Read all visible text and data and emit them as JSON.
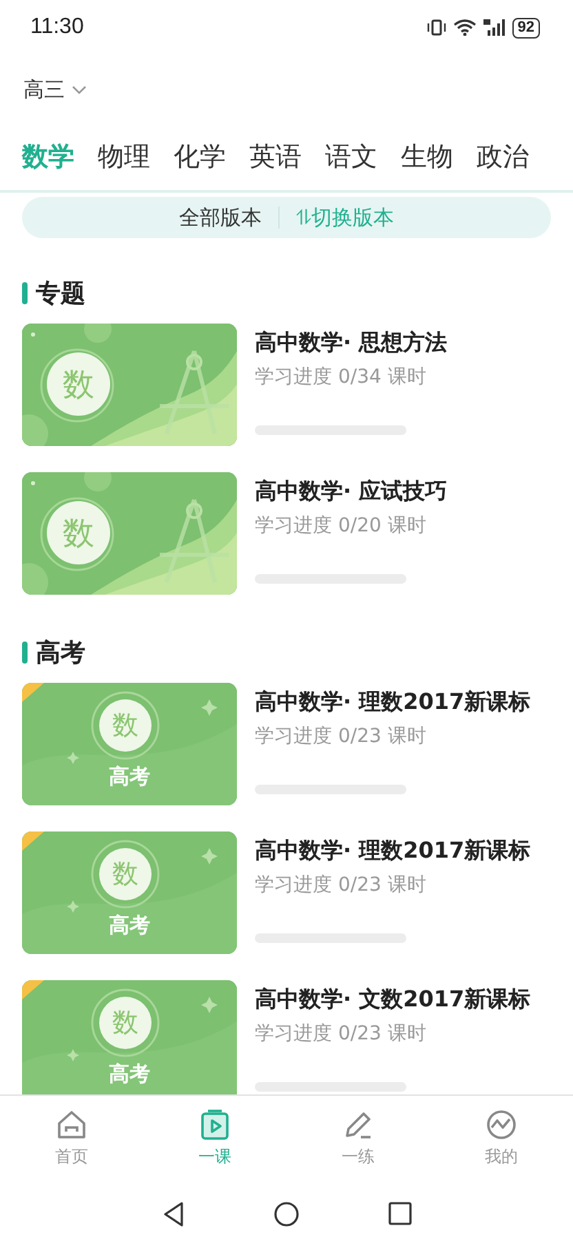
{
  "status_bar": {
    "time": "11:30",
    "battery": "92"
  },
  "grade_selector": {
    "label": "高三"
  },
  "subject_tabs": [
    {
      "label": "数学",
      "selected": true
    },
    {
      "label": "物理",
      "selected": false
    },
    {
      "label": "化学",
      "selected": false
    },
    {
      "label": "英语",
      "selected": false
    },
    {
      "label": "语文",
      "selected": false
    },
    {
      "label": "生物",
      "selected": false
    },
    {
      "label": "政治",
      "selected": false
    }
  ],
  "version_bar": {
    "current": "全部版本",
    "switch_icon": "⥮",
    "switch_label": "切换版本"
  },
  "sections": [
    {
      "title": "专题",
      "courses": [
        {
          "kind": "topic",
          "badge": "数",
          "title": "高中数学· 思想方法",
          "progress": "学习进度 0/34 课时",
          "level": 0
        },
        {
          "kind": "topic",
          "badge": "数",
          "title": "高中数学· 应试技巧",
          "progress": "学习进度 0/20 课时",
          "level": 0
        }
      ]
    },
    {
      "title": "高考",
      "courses": [
        {
          "kind": "exam",
          "badge": "数",
          "tag": "高考",
          "title": "高中数学· 理数2017新课标",
          "progress": "学习进度 0/23 课时",
          "level": 0
        },
        {
          "kind": "exam",
          "badge": "数",
          "tag": "高考",
          "title": "高中数学· 理数2017新课标",
          "progress": "学习进度 0/23 课时",
          "level": 0
        },
        {
          "kind": "exam",
          "badge": "数",
          "tag": "高考",
          "title": "高中数学· 文数2017新课标",
          "progress": "学习进度 0/23 课时",
          "level": 0
        }
      ]
    }
  ],
  "bottom_nav": [
    {
      "kind": "home",
      "label": "首页",
      "selected": false
    },
    {
      "kind": "lesson",
      "label": "一课",
      "selected": true
    },
    {
      "kind": "practice",
      "label": "一练",
      "selected": false
    },
    {
      "kind": "profile",
      "label": "我的",
      "selected": false
    }
  ]
}
